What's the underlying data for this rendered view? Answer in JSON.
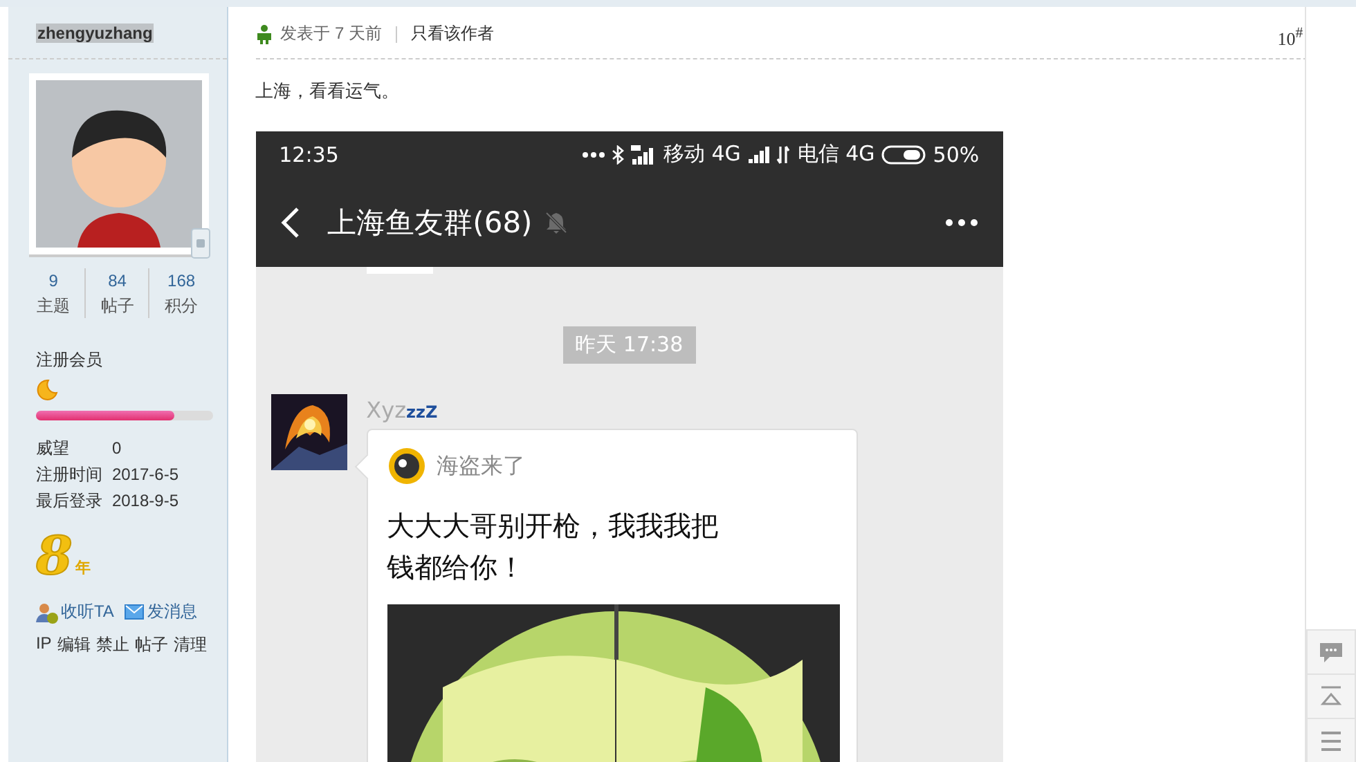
{
  "sidebar": {
    "username": "zhengyuzhang",
    "stats": [
      {
        "value": "9",
        "label": "主题"
      },
      {
        "value": "84",
        "label": "帖子"
      },
      {
        "value": "168",
        "label": "积分"
      }
    ],
    "group": "注册会员",
    "progress": {
      "level": 0.78
    },
    "info": [
      {
        "label": "威望",
        "value": "0"
      },
      {
        "label": "注册时间",
        "value": "2017-6-5"
      },
      {
        "label": "最后登录",
        "value": "2018-9-5"
      }
    ],
    "medal": {
      "number": "8",
      "unit": "年"
    },
    "actions": [
      {
        "kind": "follow",
        "label": "收听TA"
      },
      {
        "kind": "message",
        "label": "发消息"
      }
    ],
    "admin_links": [
      "IP",
      "编辑",
      "禁止",
      "帖子",
      "清理"
    ]
  },
  "post": {
    "posted": "发表于 7 天前",
    "author_only": "只看该作者",
    "floor": "10$^{#}$",
    "text": "上海，看看运气。",
    "screenshot": {
      "time": "12:35",
      "status": [
        {
          "kind": "dots"
        },
        {
          "kind": "bluetooth"
        },
        {
          "kind": "signal-hd"
        },
        {
          "kind": "text",
          "text": "移动 4G"
        },
        {
          "kind": "signal"
        },
        {
          "kind": "data"
        },
        {
          "kind": "text",
          "text": "电信 4G"
        },
        {
          "kind": "battery"
        },
        {
          "kind": "text",
          "text": "50%"
        }
      ],
      "title": "上海鱼友群(68)",
      "muted": true,
      "timestamp": "昨天 17:38",
      "message": {
        "sender": "Xyz",
        "sender_suffix": "zzZ",
        "card_name": "海盗来了",
        "card_text": [
          "大大大哥别开枪，我我我把",
          "钱都给你！"
        ]
      }
    }
  },
  "side_tools": [
    {
      "kind": "comment"
    },
    {
      "kind": "top"
    },
    {
      "kind": "list"
    }
  ]
}
